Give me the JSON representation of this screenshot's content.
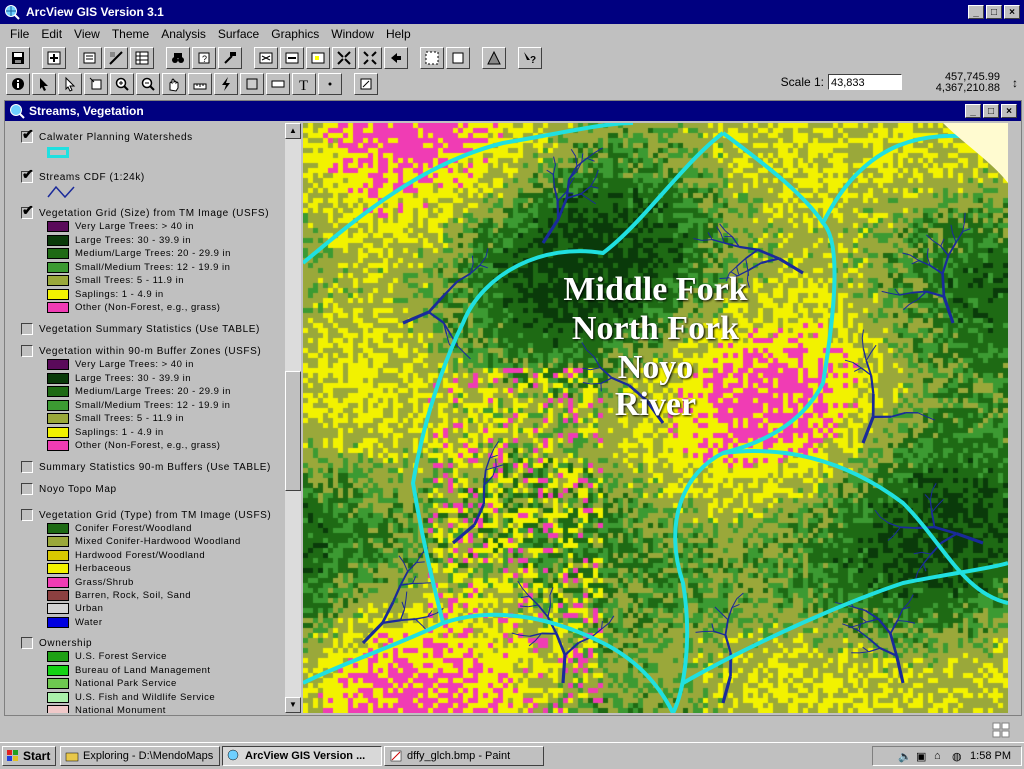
{
  "app": {
    "title": "ArcView GIS Version 3.1"
  },
  "menu": [
    "File",
    "Edit",
    "View",
    "Theme",
    "Analysis",
    "Surface",
    "Graphics",
    "Window",
    "Help"
  ],
  "scale": {
    "label": "Scale 1:",
    "value": "43,833"
  },
  "coords": {
    "x": "457,745.99",
    "y": "4,367,210.88"
  },
  "view": {
    "title": "Streams, Vegetation"
  },
  "map_label": [
    "Middle Fork",
    "North Fork",
    "Noyo",
    "River"
  ],
  "toc": {
    "calwater": "Calwater Planning Watersheds",
    "streams": "Streams CDF (1:24k)",
    "veg_size": "Vegetation Grid (Size) from TM Image (USFS)",
    "veg_size_items": [
      {
        "label": "Very Large Trees: > 40  in",
        "color": "#5a0a5a"
      },
      {
        "label": "Large Trees: 30 - 39.9 in",
        "color": "#0a3a0a"
      },
      {
        "label": "Medium/Large Trees: 20 - 29.9 in",
        "color": "#1e6a14"
      },
      {
        "label": "Small/Medium Trees: 12 - 19.9 in",
        "color": "#3c9a32"
      },
      {
        "label": "Small Trees: 5 - 11.9 in",
        "color": "#9aa83a"
      },
      {
        "label": "Saplings: 1 - 4.9 in",
        "color": "#f2f200"
      },
      {
        "label": "Other (Non-Forest, e.g., grass)",
        "color": "#f03cb4"
      }
    ],
    "veg_summary": "Vegetation Summary Statistics (Use TABLE)",
    "veg_buffer": "Vegetation within 90-m Buffer Zones (USFS)",
    "veg_buffer_items": [
      {
        "label": "Very Large Trees: > 40  in",
        "color": "#5a0a5a"
      },
      {
        "label": "Large Trees: 30 - 39.9 in",
        "color": "#0a3a0a"
      },
      {
        "label": "Medium/Large Trees: 20 - 29.9 in",
        "color": "#1e6a14"
      },
      {
        "label": "Small/Medium Trees: 12 - 19.9 in",
        "color": "#3c9a32"
      },
      {
        "label": "Small Trees: 5 - 11.9 in",
        "color": "#9aa83a"
      },
      {
        "label": "Saplings: 1 - 4.9 in",
        "color": "#f2f200"
      },
      {
        "label": "Other (Non-Forest, e.g., grass)",
        "color": "#f03cb4"
      }
    ],
    "summary_buffers": "Summary Statistics 90-m Buffers (Use TABLE)",
    "noyo_topo": "Noyo Topo Map",
    "veg_type": "Vegetation Grid (Type) from TM Image (USFS)",
    "veg_type_items": [
      {
        "label": "Conifer Forest/Woodland",
        "color": "#1e6a14"
      },
      {
        "label": "Mixed Conifer-Hardwood Woodland",
        "color": "#9aa83a"
      },
      {
        "label": "Hardwood Forest/Woodland",
        "color": "#d8c800"
      },
      {
        "label": "Herbaceous",
        "color": "#f2f200"
      },
      {
        "label": "Grass/Shrub",
        "color": "#f03cb4"
      },
      {
        "label": "Barren, Rock, Soil, Sand",
        "color": "#8c4040"
      },
      {
        "label": "Urban",
        "color": "#d4d4d4"
      },
      {
        "label": "Water",
        "color": "#0000e0"
      }
    ],
    "ownership": "Ownership",
    "ownership_items": [
      {
        "label": "U.S. Forest Service",
        "color": "#1ea014"
      },
      {
        "label": "Bureau of Land Management",
        "color": "#14d214"
      },
      {
        "label": "National Park Service",
        "color": "#6ec850"
      },
      {
        "label": "U.S. Fish and Wildlife Service",
        "color": "#aaf0aa"
      },
      {
        "label": "National Monument",
        "color": "#f0c8c8"
      }
    ]
  },
  "taskbar": {
    "start": "Start",
    "tasks": [
      "Exploring - D:\\MendoMaps",
      "ArcView GIS Version ...",
      "dffy_glch.bmp - Paint"
    ],
    "clock": "1:58 PM"
  },
  "colors": {
    "title_bar": "#000080",
    "stream": "#1a2a9a",
    "watershed": "#20e0e0"
  }
}
